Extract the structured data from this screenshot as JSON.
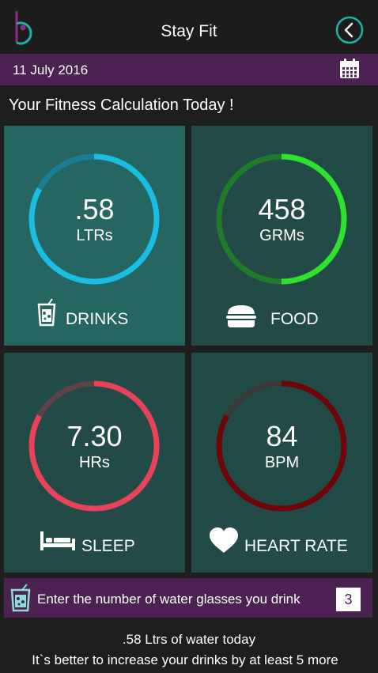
{
  "header": {
    "title": "Stay Fit",
    "logo_icon": "b-logo-icon",
    "back_icon": "chevron-left-circle-icon"
  },
  "datebar": {
    "date": "11 July 2016",
    "calendar_icon": "calendar-icon"
  },
  "section_title": "Your Fitness Calculation Today !",
  "tiles": [
    {
      "key": "drinks",
      "value": ".58",
      "unit": "LTRs",
      "label": "DRINKS",
      "icon": "drink-glass-icon",
      "progress": 0.83,
      "ring_color": "#1bbee3",
      "track_color": "#1a7f94"
    },
    {
      "key": "food",
      "value": "458",
      "unit": "GRMs",
      "label": "FOOD",
      "icon": "burger-icon",
      "progress": 0.5,
      "ring_color": "#2ee22e",
      "track_color": "#1f7a2a"
    },
    {
      "key": "sleep",
      "value": "7.30",
      "unit": "HRs",
      "label": "SLEEP",
      "icon": "bed-icon",
      "progress": 0.83,
      "ring_color": "#e8435a",
      "track_color": "#5e4249"
    },
    {
      "key": "heart",
      "value": "84",
      "unit": "BPM",
      "label": "HEART RATE",
      "icon": "heart-icon",
      "progress": 0.83,
      "ring_color": "#6e0609",
      "track_color": "#3a3a3a"
    }
  ],
  "input": {
    "prompt": "Enter the number of water glasses you drink",
    "value": "3",
    "icon": "water-glass-icon"
  },
  "summary": {
    "line1": ".58 Ltrs of water today",
    "line2": "It`s better to increase your drinks by at least 5 more"
  },
  "colors": {
    "accent_purple": "#4b2252",
    "tile_bg": "#224a47",
    "tile_active_bg": "#256662",
    "logo_teal": "#1bb3a8",
    "logo_purple": "#8a2b8f"
  }
}
